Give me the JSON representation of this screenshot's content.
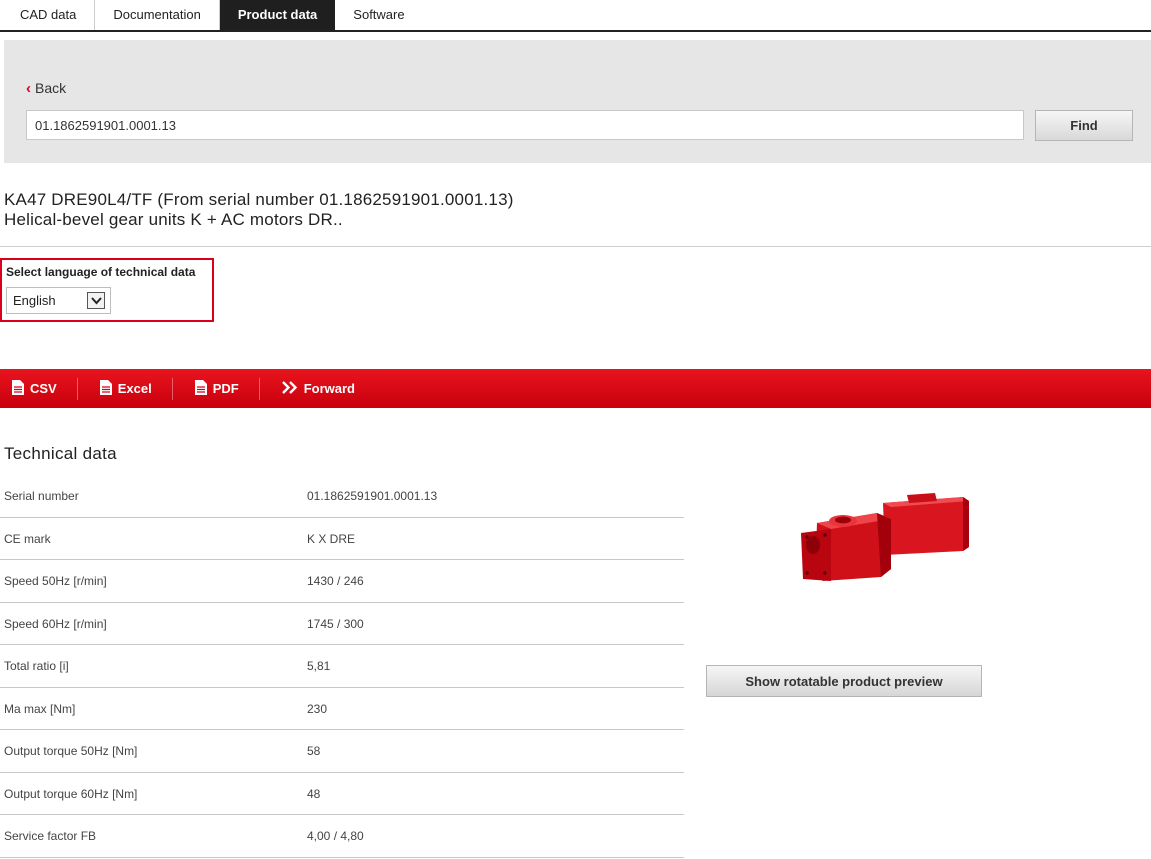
{
  "tabs": [
    {
      "label": "CAD data",
      "active": false
    },
    {
      "label": "Documentation",
      "active": false
    },
    {
      "label": "Product data",
      "active": true
    },
    {
      "label": "Software",
      "active": false
    }
  ],
  "search": {
    "back_label": "Back",
    "value": "01.1862591901.0001.13",
    "find_label": "Find"
  },
  "product": {
    "title_line1": "KA47 DRE90L4/TF (From serial number 01.1862591901.0001.13)",
    "title_line2": "Helical-bevel gear units K + AC motors DR.."
  },
  "language": {
    "label": "Select language of technical data",
    "selected": "English"
  },
  "toolbar": {
    "csv": "CSV",
    "excel": "Excel",
    "pdf": "PDF",
    "forward": "Forward"
  },
  "technical": {
    "title": "Technical data",
    "rows": [
      {
        "label": "Serial number",
        "value": "01.1862591901.0001.13"
      },
      {
        "label": "CE mark",
        "value": "K X DRE"
      },
      {
        "label": "Speed 50Hz [r/min]",
        "value": "1430 / 246"
      },
      {
        "label": "Speed 60Hz [r/min]",
        "value": "1745 / 300"
      },
      {
        "label": "Total ratio [i]",
        "value": "5,81"
      },
      {
        "label": "Ma max [Nm]",
        "value": "230"
      },
      {
        "label": "Output torque 50Hz [Nm]",
        "value": "58"
      },
      {
        "label": "Output torque 60Hz [Nm]",
        "value": "48"
      },
      {
        "label": "Service factor FB",
        "value": "4,00 / 4,80"
      }
    ]
  },
  "preview": {
    "button_label": "Show rotatable product preview"
  },
  "colors": {
    "brand_red": "#d9001b",
    "tab_active": "#1f1f1f",
    "panel_gray": "#e6e6e6"
  }
}
